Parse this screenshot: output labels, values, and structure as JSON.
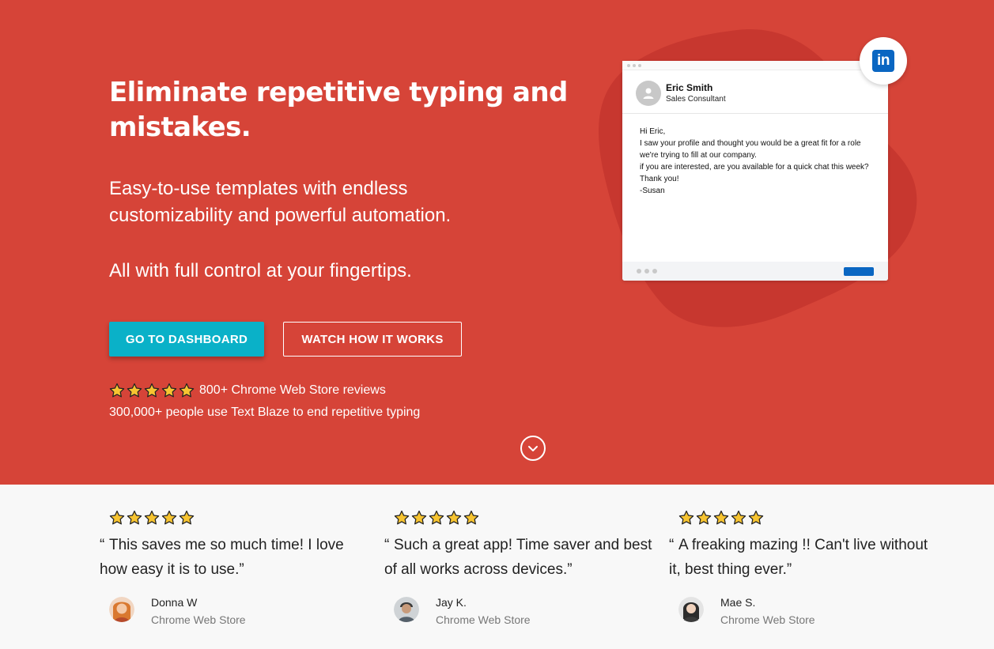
{
  "hero": {
    "headline": "Eliminate repetitive typing and mistakes.",
    "subtitle": "Easy-to-use templates with endless customizability and powerful automation.",
    "tagline": "All with full control at your fingertips.",
    "primary_cta": "GO TO DASHBOARD",
    "secondary_cta": "WATCH HOW IT WORKS",
    "rating": {
      "stars": 5,
      "text": "800+ Chrome Web Store reviews"
    },
    "users_text": "300,000+ people use Text Blaze to end repetitive typing"
  },
  "mockup": {
    "name": "Eric Smith",
    "role": "Sales Consultant",
    "message": [
      "Hi Eric,",
      "I saw your profile and thought you would be a great fit for a role we're trying to fill at our company.",
      "if you are interested, are you available for a quick chat this week?",
      "Thank you!",
      "-Susan"
    ],
    "badge_logo": "in"
  },
  "testimonials": [
    {
      "stars": 5,
      "open_quote": "“",
      "quote": "This saves me so much time! I love how easy it is to use.”",
      "author": "Donna W",
      "source": "Chrome Web Store"
    },
    {
      "stars": 5,
      "open_quote": "“",
      "quote": "Such a great app! Time saver and best of all works across devices.”",
      "author": "Jay K.",
      "source": "Chrome Web Store"
    },
    {
      "stars": 5,
      "open_quote": "“",
      "quote": "A freaking mazing !! Can't live without it, best thing ever.”",
      "author": "Mae S.",
      "source": "Chrome Web Store"
    }
  ],
  "colors": {
    "hero_bg": "#d64438",
    "blob": "#c7372f",
    "primary_button": "#0ab1c8",
    "linkedin_blue": "#0a66c2",
    "star_fill": "#f7c431"
  },
  "icons": {
    "star": "star-icon",
    "scroll": "chevron-down-icon",
    "profile": "user-avatar-icon",
    "linkedin": "linkedin-icon"
  }
}
